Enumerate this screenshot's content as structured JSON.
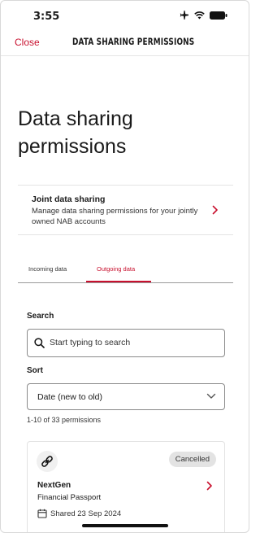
{
  "status_bar": {
    "time": "3:55"
  },
  "nav": {
    "close_label": "Close",
    "title": "DATA SHARING PERMISSIONS"
  },
  "page": {
    "title": "Data sharing permissions"
  },
  "joint": {
    "title": "Joint data sharing",
    "description": "Manage data sharing permissions for your jointly owned NAB accounts",
    "icon": "chevron-right-icon"
  },
  "tabs": [
    {
      "label": "Incoming data",
      "selected": false
    },
    {
      "label": "Outgoing data",
      "selected": true
    }
  ],
  "search": {
    "label": "Search",
    "placeholder": "Start typing to search"
  },
  "sort": {
    "label": "Sort",
    "selected": "Date (new to old)"
  },
  "results": {
    "count_text": "1-10 of 33 permissions"
  },
  "cards": [
    {
      "icon": "link-icon",
      "status": "Cancelled",
      "name": "NextGen",
      "product": "Financial Passport",
      "date_text": "Shared 23 Sep 2024"
    }
  ],
  "colors": {
    "accent": "#c8102e",
    "badge_bg": "#e3e3e3"
  }
}
